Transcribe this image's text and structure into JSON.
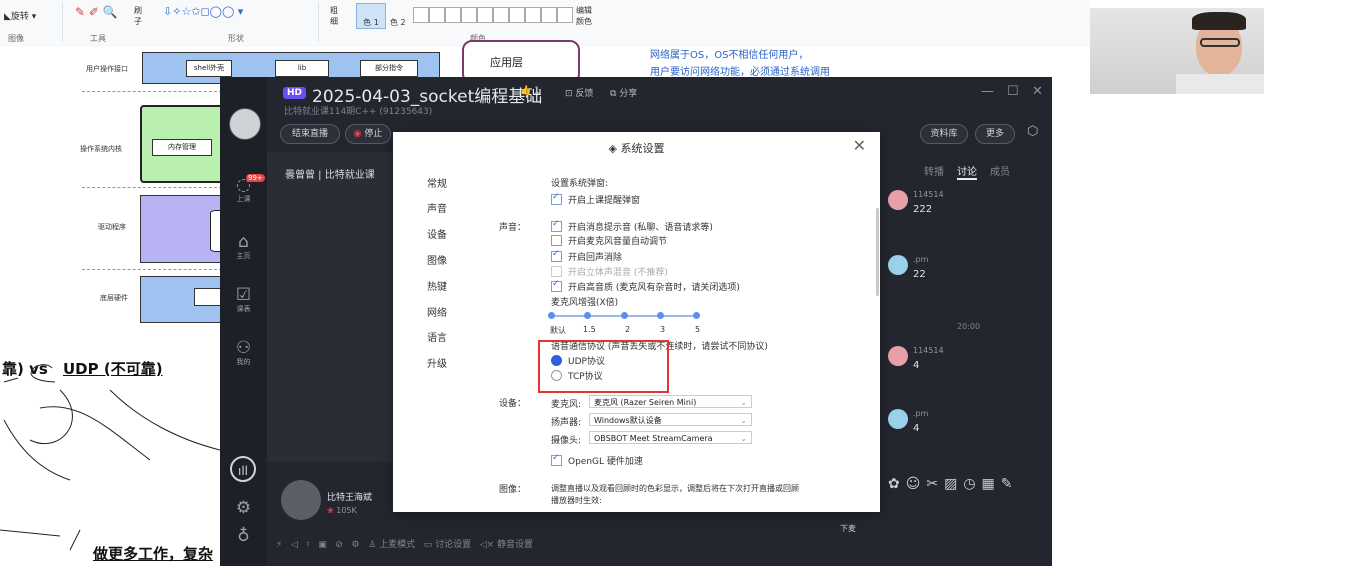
{
  "paint": {
    "ribbon": {
      "rotate_label": "旋转",
      "image_group": "图像",
      "tools_group": "工具",
      "shapes_group": "形状",
      "colors_group": "颜色",
      "brush_label": "刷子",
      "thickness_label": "粗细",
      "color1_label": "色 1",
      "color2_label": "色 2",
      "edit_colors_label": "编辑颜色"
    },
    "diagram": {
      "user_interface": "用户操作接口",
      "shell": "shell外壳",
      "lib": "lib",
      "part_cmd": "部分指令",
      "app_layer": "应用层",
      "os_kernel": "操作系统内核",
      "mem_mgmt": "内存管理",
      "driver": "驱动程序",
      "hardware": "底层硬件",
      "note_line1": "网络属于OS，OS不相信任何用户，",
      "note_line2": "用户要访问网络功能，必须通过系统调用"
    },
    "handwriting": {
      "vs_prefix": "靠)  vs",
      "udp": "UDP (不可靠)",
      "more_work": "做更多工作，复杂"
    }
  },
  "app": {
    "hd_badge": "HD",
    "title": "2025-04-03_socket编程基础",
    "like_count": "1",
    "feedback": "反馈",
    "share": "分享",
    "subtitle": "比特就业课114期C++ (91235643)",
    "end_live": "结束直播",
    "stop": "停止",
    "resource_lib": "资料库",
    "more": "更多",
    "rail": {
      "badge": "99+",
      "class": "上课",
      "home": "主页",
      "schedule": "课表",
      "mine": "我的"
    },
    "studio": "曇曾曾 | 比特就业课",
    "host_name": "比特王海斌",
    "host_stat": "105K",
    "bottom_bar": {
      "mic_mode": "上麦模式",
      "discussion_settings": "讨论设置",
      "mute_settings": "静音设置"
    },
    "mic_off": "下麦",
    "chat": {
      "tabs": [
        "转播",
        "讨论",
        "成员"
      ],
      "active_tab": "讨论",
      "messages": [
        {
          "name": "114514",
          "text": "222"
        },
        {
          "name": ".pm",
          "text": "22"
        },
        {
          "name": "114514",
          "text": "4"
        },
        {
          "name": ".pm",
          "text": "4"
        }
      ],
      "time_divider": "20:00"
    }
  },
  "settings": {
    "title": "系统设置",
    "nav": [
      "常规",
      "声音",
      "设备",
      "图像",
      "热键",
      "网络",
      "语言",
      "升级"
    ],
    "popup_header": "设置系统弹窗:",
    "popup_option": "开启上课提醒弹窗",
    "sound_label": "声音：",
    "sound_options": [
      {
        "label": "开启消息提示音 (私聊、语音请求等)",
        "checked": true,
        "disabled": false
      },
      {
        "label": "开启麦克风音量自动调节",
        "checked": false,
        "disabled": false
      },
      {
        "label": "开启回声消除",
        "checked": true,
        "disabled": false
      },
      {
        "label": "开启立体声混音 (不推荐)",
        "checked": false,
        "disabled": true
      },
      {
        "label": "开启高音质 (麦克风有杂音时，请关闭选项)",
        "checked": true,
        "disabled": false
      }
    ],
    "mic_boost_label": "麦克风增强(X倍)",
    "mic_boost_ticks": [
      "默认",
      "1.5",
      "2",
      "3",
      "5"
    ],
    "protocol_label": "语音通信协议 (声音丢失或不连续时，请尝试不同协议)",
    "protocol_options": [
      "UDP协议",
      "TCP协议"
    ],
    "protocol_selected": "UDP协议",
    "device_label": "设备：",
    "mic_label": "麦克风:",
    "mic_value": "麦克风 (Razer Seiren Mini)",
    "speaker_label": "扬声器:",
    "speaker_value": "Windows默认设备",
    "camera_label": "摄像头:",
    "camera_value": "OBSBOT Meet StreamCamera",
    "opengl": "OpenGL 硬件加速",
    "image_label": "图像：",
    "image_desc1": "调整直播以及观看回顾时的色彩显示，调整后将在下次打开直播或回顾",
    "image_desc2": "播放器时生效:"
  }
}
